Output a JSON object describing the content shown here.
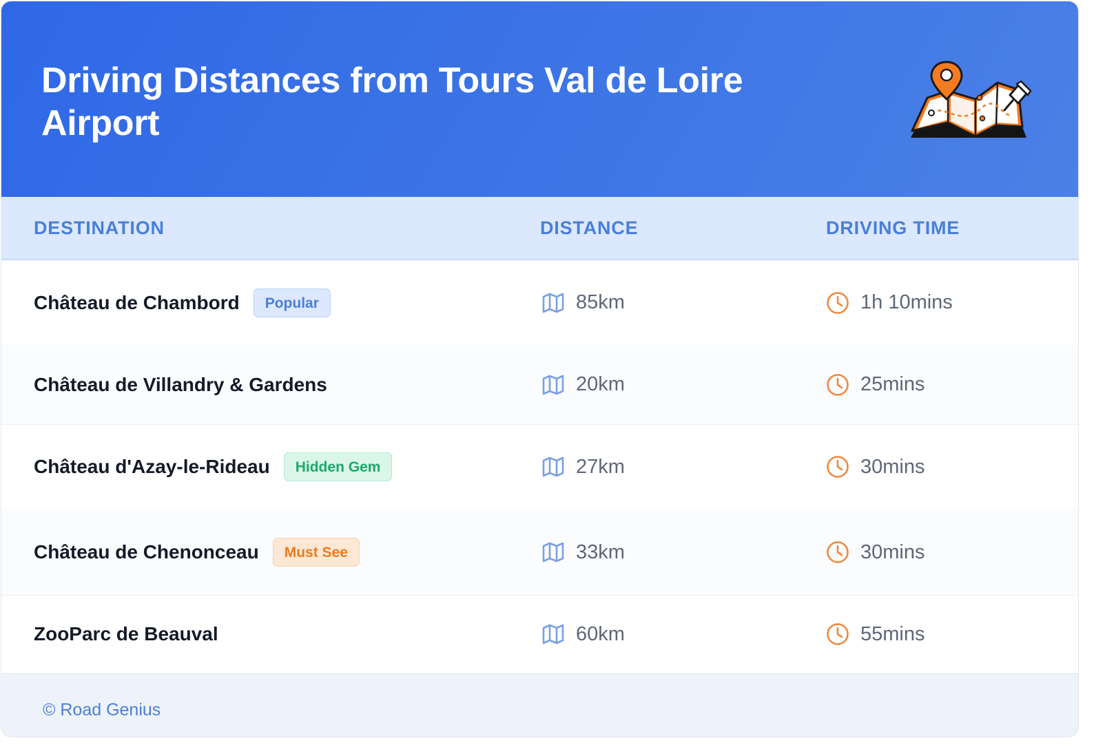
{
  "header": {
    "title": "Driving Distances from Tours Val de Loire Airport",
    "illustration": "folded-map-with-pins-icon"
  },
  "table": {
    "columns": {
      "destination": "DESTINATION",
      "distance": "DISTANCE",
      "driving_time": "DRIVING TIME"
    },
    "rows": [
      {
        "destination": "Château de Chambord",
        "badge": "Popular",
        "badge_color": "#4a7fd9",
        "distance": "85km",
        "time": "1h 10mins"
      },
      {
        "destination": "Château de Villandry & Gardens",
        "badge": "",
        "badge_color": "",
        "distance": "20km",
        "time": "25mins"
      },
      {
        "destination": "Château d'Azay-le-Rideau",
        "badge": "Hidden Gem",
        "badge_color": "#1ea96a",
        "distance": "27km",
        "time": "30mins"
      },
      {
        "destination": "Château de Chenonceau",
        "badge": "Must See",
        "badge_color": "#f07a1a",
        "distance": "33km",
        "time": "30mins"
      },
      {
        "destination": "ZooParc de Beauval",
        "badge": "",
        "badge_color": "",
        "distance": "60km",
        "time": "55mins"
      }
    ],
    "distance_icon": "map-icon",
    "time_icon": "clock-icon"
  },
  "footer": {
    "copyright": "© Road Genius"
  },
  "colors": {
    "header_gradient_start": "#2f68e6",
    "header_gradient_end": "#4b80e6",
    "accent_blue": "#4a7fd9",
    "accent_orange": "#f0883e",
    "text_dark": "#151a27",
    "text_muted": "#5f6675"
  }
}
